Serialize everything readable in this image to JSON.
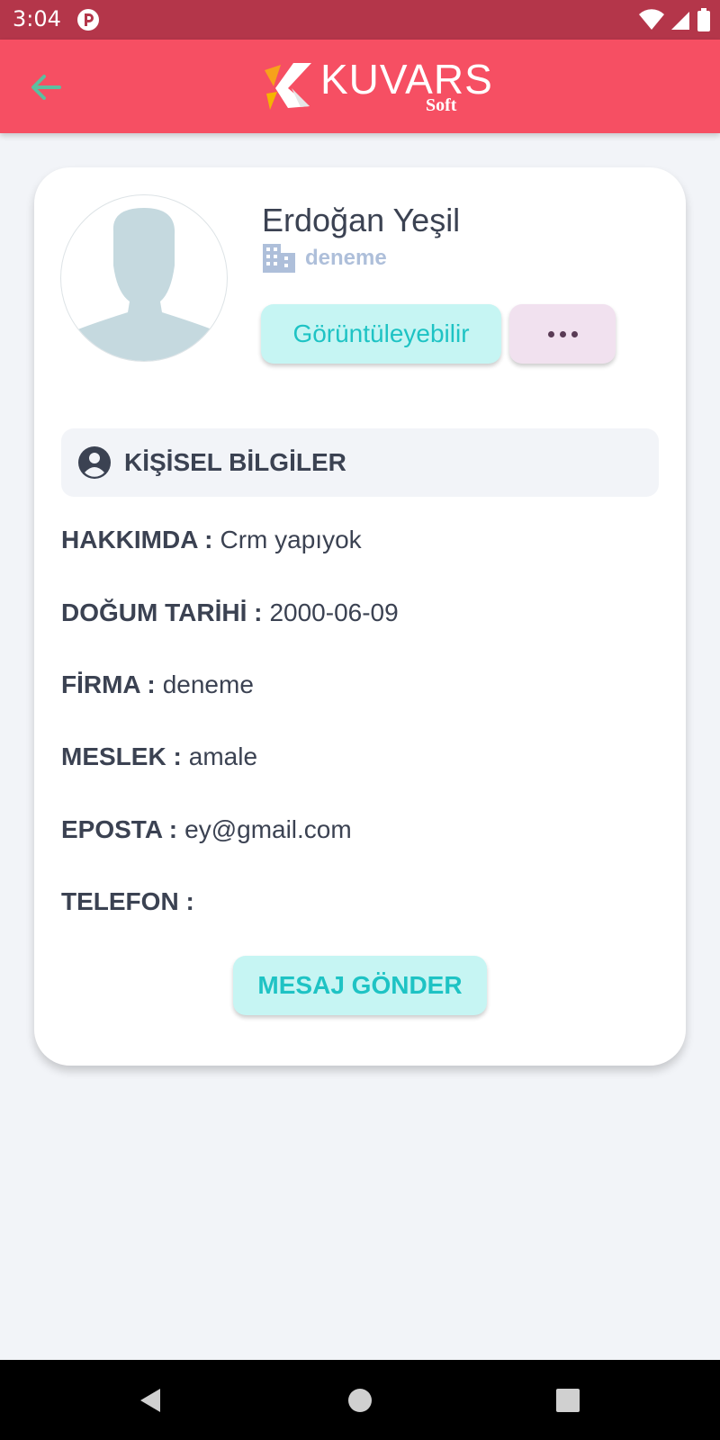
{
  "status_bar": {
    "time": "3:04"
  },
  "app_bar": {
    "logo_text": "KUVARS",
    "logo_sub": "Soft"
  },
  "profile": {
    "name": "Erdoğan Yeşil",
    "company": "deneme",
    "visibility_label": "Görüntüleyebilir"
  },
  "section": {
    "title": "KİŞİSEL BİLGİLER"
  },
  "info": [
    {
      "label": "HAKKIMDA :",
      "value": "Crm yapıyok"
    },
    {
      "label": "DOĞUM TARİHİ :",
      "value": "2000-06-09"
    },
    {
      "label": "FİRMA :",
      "value": "deneme"
    },
    {
      "label": "MESLEK :",
      "value": "amale"
    },
    {
      "label": "EPOSTA :",
      "value": "ey@gmail.com"
    },
    {
      "label": "TELEFON :",
      "value": ""
    }
  ],
  "actions": {
    "message_label": "MESAJ GÖNDER"
  },
  "colors": {
    "status_bar": "#b4364a",
    "app_bar": "#f64f63",
    "accent_teal": "#1ec3c4",
    "teal_bg": "#c6f5f3",
    "more_bg": "#f1e1ef",
    "text_dark": "#3b4252",
    "company_text": "#aebfda",
    "back_arrow": "#5bbfa0"
  },
  "icons": {
    "back": "arrow-left-icon",
    "company": "building-icon",
    "section": "account-circle-icon",
    "more": "more-horizontal-icon"
  }
}
